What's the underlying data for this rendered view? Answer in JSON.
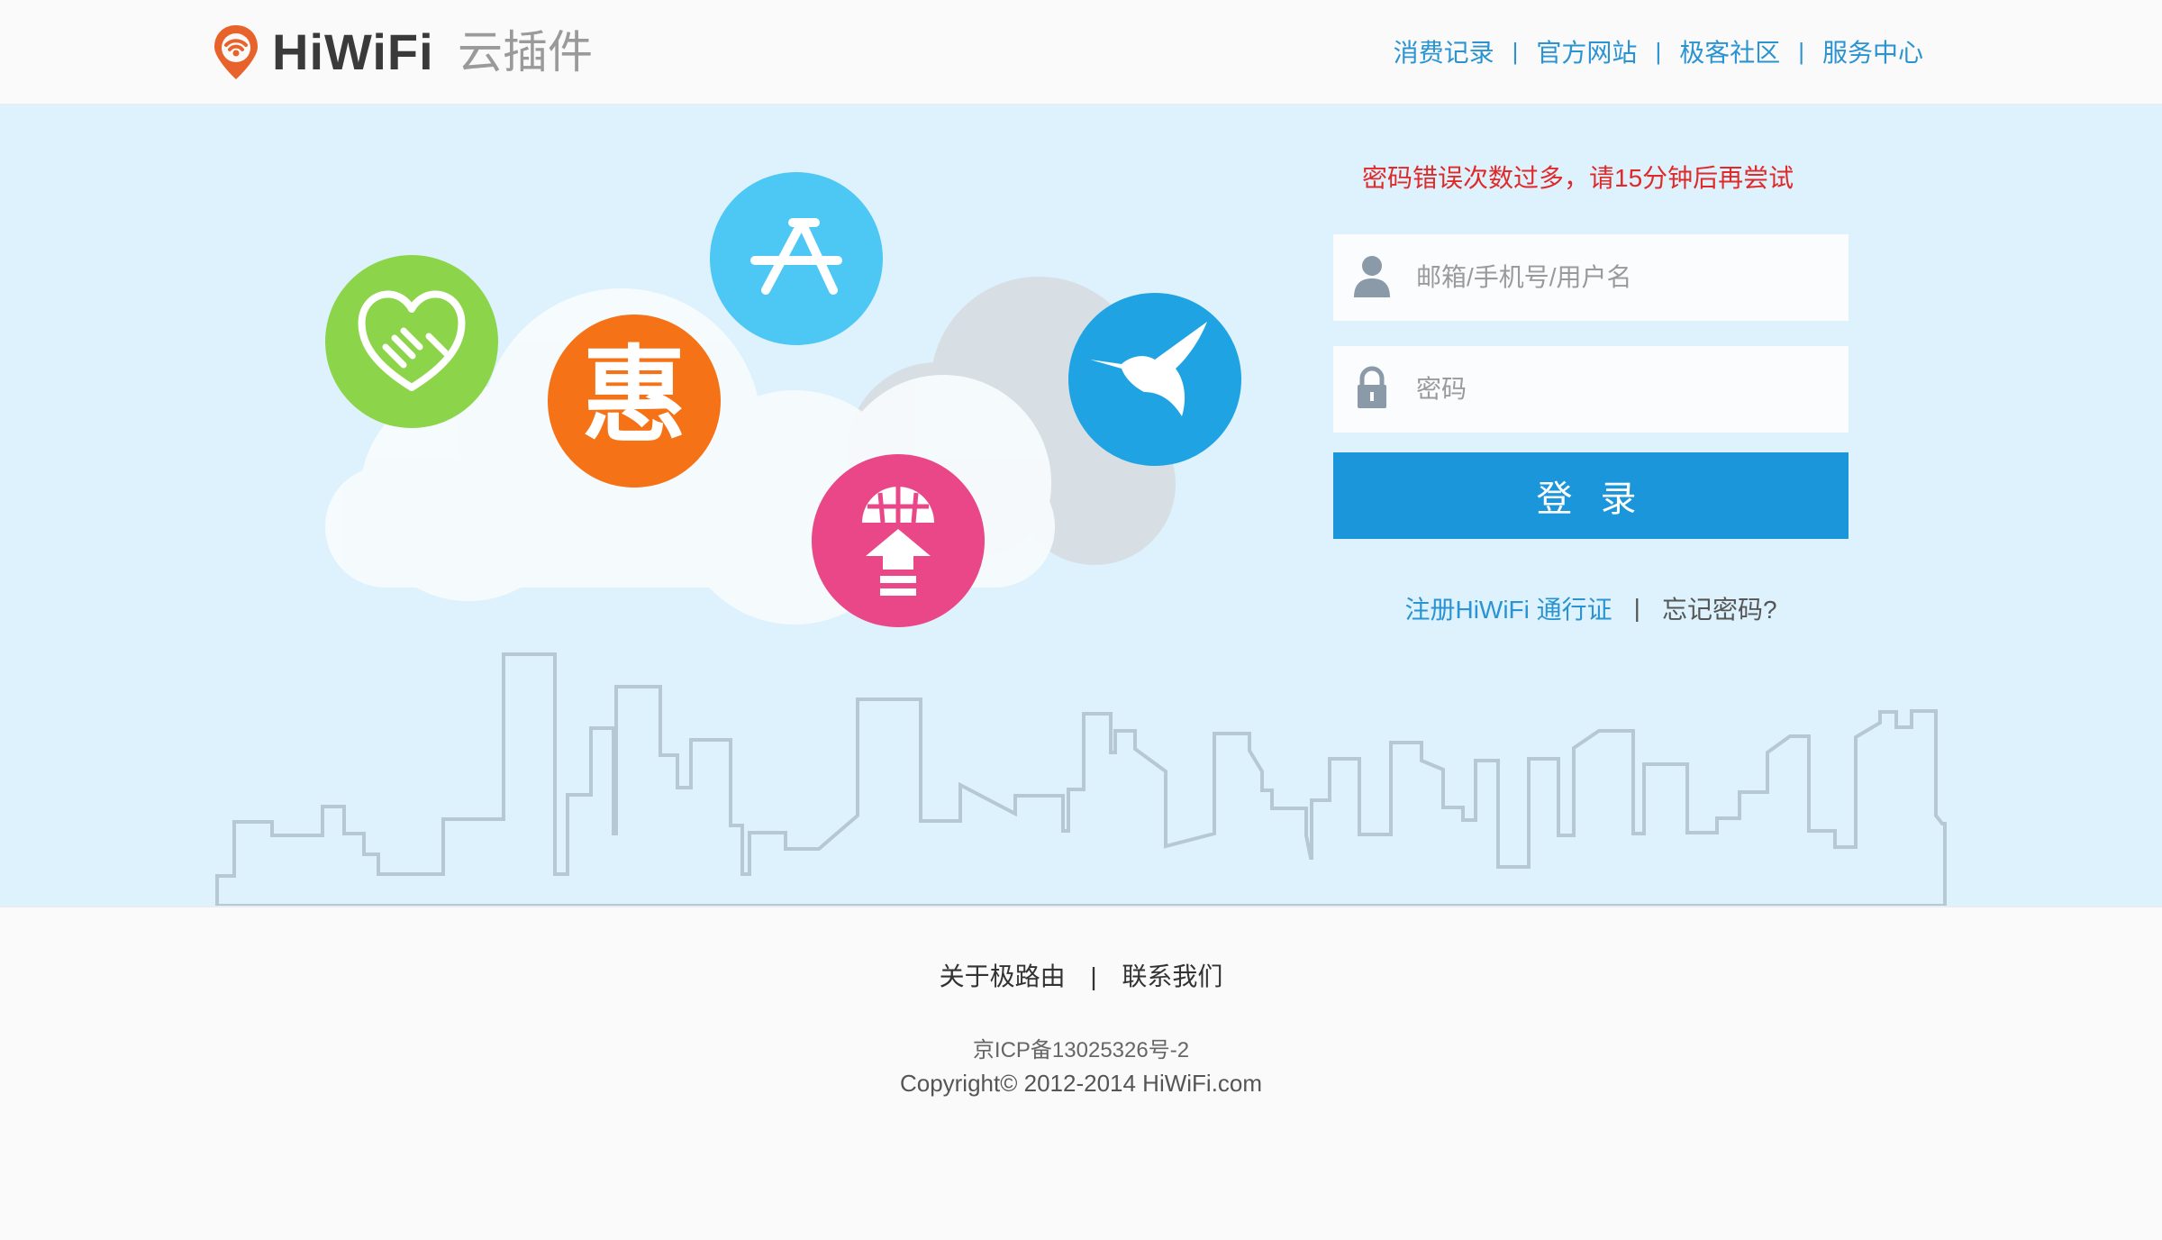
{
  "header": {
    "logo_text": "HiWiFi",
    "logo_sub": "云插件",
    "nav": [
      "消费记录",
      "官方网站",
      "极客社区",
      "服务中心"
    ],
    "nav_separator": "|"
  },
  "hero": {
    "app_icons": [
      "handshake-icon",
      "hui-discount-icon",
      "app-store-icon",
      "globe-upload-icon",
      "hummingbird-icon"
    ]
  },
  "login": {
    "error_message": "密码错误次数过多，请15分钟后再尝试",
    "username_placeholder": "邮箱/手机号/用户名",
    "username_value": "",
    "password_placeholder": "密码",
    "password_value": "",
    "submit_label": "登 录",
    "register_link": "注册HiWiFi 通行证",
    "separator": "|",
    "forgot_link": "忘记密码?"
  },
  "footer": {
    "links": [
      "关于极路由",
      "联系我们"
    ],
    "separator": "|",
    "icp": "京ICP备13025326号-2",
    "copyright": "Copyright© 2012-2014 HiWiFi.com"
  },
  "colors": {
    "accent": "#1c96da",
    "link": "#2a93d2",
    "error": "#e02a2a",
    "hero_bg": "#ddf2fc",
    "logo_orange": "#e8632b"
  }
}
